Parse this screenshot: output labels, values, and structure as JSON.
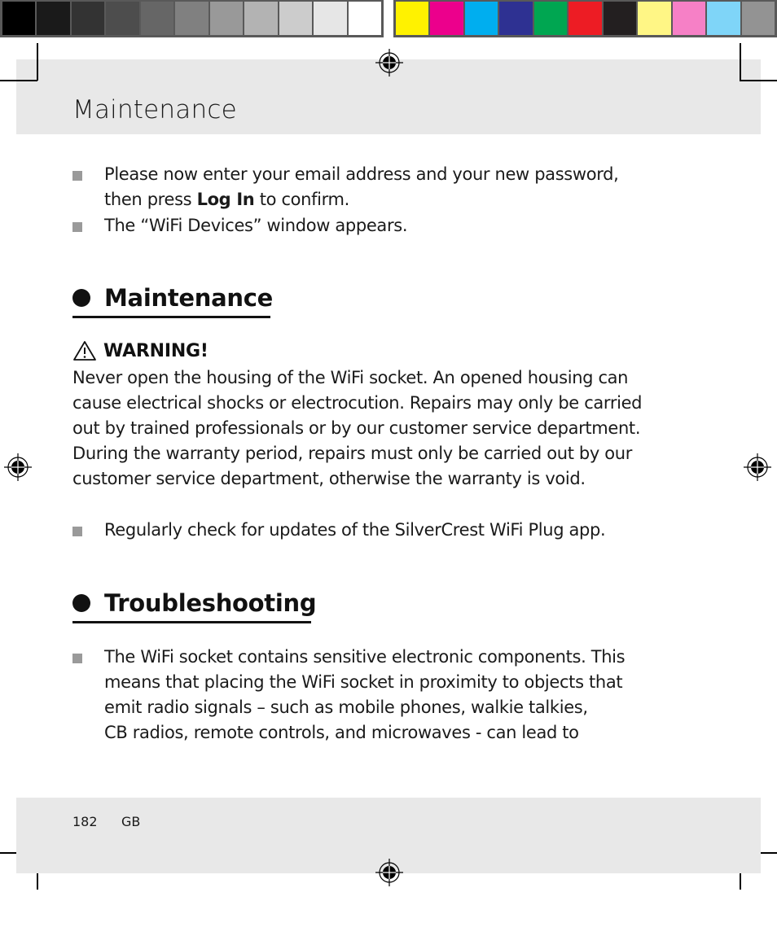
{
  "color_bars": {
    "gray_swatches": [
      "#000000",
      "#1a1a1a",
      "#333333",
      "#4d4d4d",
      "#666666",
      "#808080",
      "#999999",
      "#b3b3b3",
      "#cccccc",
      "#e6e6e6",
      "#ffffff"
    ],
    "color_swatches": [
      "#fff200",
      "#ec008c",
      "#00aeef",
      "#2e3192",
      "#00a651",
      "#ed1c24",
      "#231f20",
      "#fff685",
      "#f680c6",
      "#7fd5f8",
      "#939393"
    ]
  },
  "header": {
    "title": "Maintenance"
  },
  "intro_bullets": [
    {
      "line1": "Please now enter your email address and your new password,",
      "line2_pre": "then press ",
      "line2_bold": "Log In",
      "line2_post": " to confirm."
    },
    {
      "line1": "The “WiFi Devices” window appears."
    }
  ],
  "sections": [
    {
      "title": "Maintenance",
      "warning": {
        "icon": "warning-triangle-icon",
        "label": "WARNING!",
        "lines": [
          "Never open the housing of the WiFi socket. An opened housing can",
          "cause electrical shocks or electrocution. Repairs may only be carried",
          "out by trained professionals or by our customer service department.",
          "During the warranty period, repairs must only be carried out by our",
          "customer service department, otherwise the warranty is void."
        ]
      },
      "bullets": [
        "Regularly check for updates of the SilverCrest WiFi Plug app."
      ]
    },
    {
      "title": "Troubleshooting",
      "bullets": [
        {
          "lines": [
            "The WiFi socket contains sensitive electronic components. This",
            "means that placing the WiFi socket in proximity to objects that",
            "emit radio signals – such as mobile phones, walkie talkies,",
            "CB radios, remote controls, and microwaves - can lead to"
          ]
        }
      ]
    }
  ],
  "footer": {
    "page_number": "182",
    "language": "GB"
  }
}
